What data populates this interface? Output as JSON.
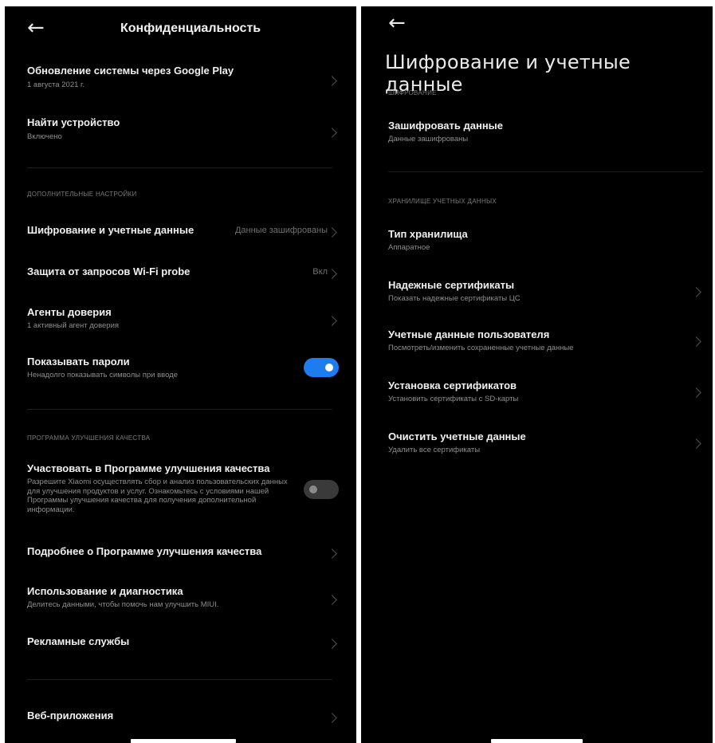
{
  "left": {
    "title": "Конфиденциальность",
    "items_top": [
      {
        "title": "Обновление системы через Google Play",
        "subtitle": "1 августа 2021 г."
      },
      {
        "title": "Найти устройство",
        "subtitle": "Включено"
      }
    ],
    "section_advanced": "ДОПОЛНИТЕЛЬНЫЕ НАСТРОЙКИ",
    "items_advanced": [
      {
        "title": "Шифрование и учетные данные",
        "value": "Данные зашифрованы"
      },
      {
        "title": "Защита от запросов Wi-Fi probe",
        "value": "Вкл"
      },
      {
        "title": "Агенты доверия",
        "subtitle": "1 активный агент доверия"
      },
      {
        "title": "Показывать пароли",
        "subtitle": "Ненадолго показывать символы при вводе",
        "toggle": true
      }
    ],
    "section_quality": "ПРОГРАММА УЛУЧШЕНИЯ КАЧЕСТВА",
    "quality_program": {
      "title": "Участвовать в Программе улучшения качества",
      "description": "Разрешите Xiaomi осуществлять сбор и анализ пользовательских данных для улучшения продуктов и услуг. Ознакомьтесь с условиями нашей Программы улучшения качества для получения дополнительной информации.",
      "toggle": false
    },
    "items_quality": [
      {
        "title": "Подробнее о Программе улучшения качества"
      },
      {
        "title": "Использование и диагностика",
        "subtitle": "Делитесь данными, чтобы помочь нам улучшить MIUI."
      },
      {
        "title": "Рекламные службы"
      }
    ],
    "items_bottom": [
      {
        "title": "Веб-приложения"
      }
    ]
  },
  "right": {
    "title": "Шифрование и учетные данные",
    "section_encryption": "ШИФРОВАНИЕ",
    "items_encryption": [
      {
        "title": "Зашифровать данные",
        "subtitle": "Данные зашифрованы"
      }
    ],
    "section_storage": "ХРАНИЛИЩЕ УЧЕТНЫХ ДАННЫХ",
    "items_storage": [
      {
        "title": "Тип хранилища",
        "subtitle": "Аппаратное"
      },
      {
        "title": "Надежные сертификаты",
        "subtitle": "Показать надежные сертификаты ЦС"
      },
      {
        "title": "Учетные данные пользователя",
        "subtitle": "Посмотреть/изменить сохраненные учетные данные"
      },
      {
        "title": "Установка сертификатов",
        "subtitle": "Установить сертификаты с SD-карты"
      },
      {
        "title": "Очистить учетные данные",
        "subtitle": "Удалить все сертификаты"
      }
    ]
  }
}
